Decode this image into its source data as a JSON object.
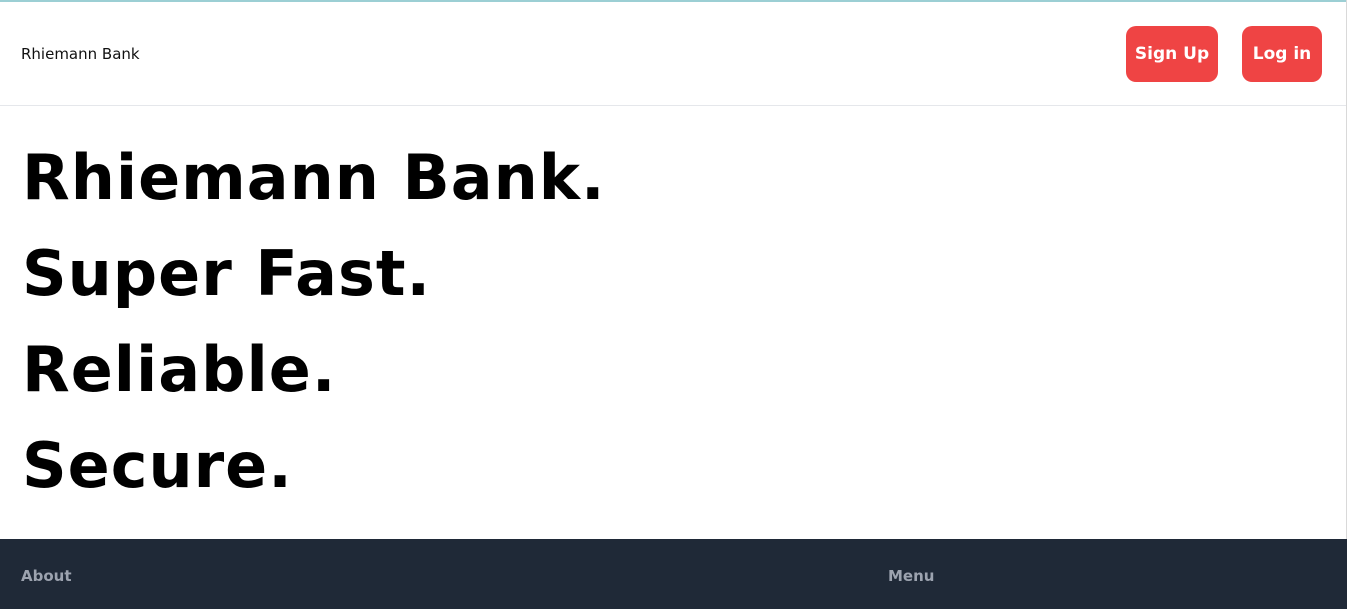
{
  "header": {
    "brand": "Rhiemann Bank",
    "signup_label": "Sign Up",
    "login_label": "Log in"
  },
  "hero": {
    "lines": [
      "Rhiemann Bank.",
      "Super Fast.",
      "Reliable.",
      "Secure."
    ]
  },
  "footer": {
    "about_heading": "About",
    "menu_heading": "Menu"
  },
  "colors": {
    "accent": "#ef4444",
    "footer_bg": "#1f2937",
    "footer_text": "#9ca3af"
  }
}
